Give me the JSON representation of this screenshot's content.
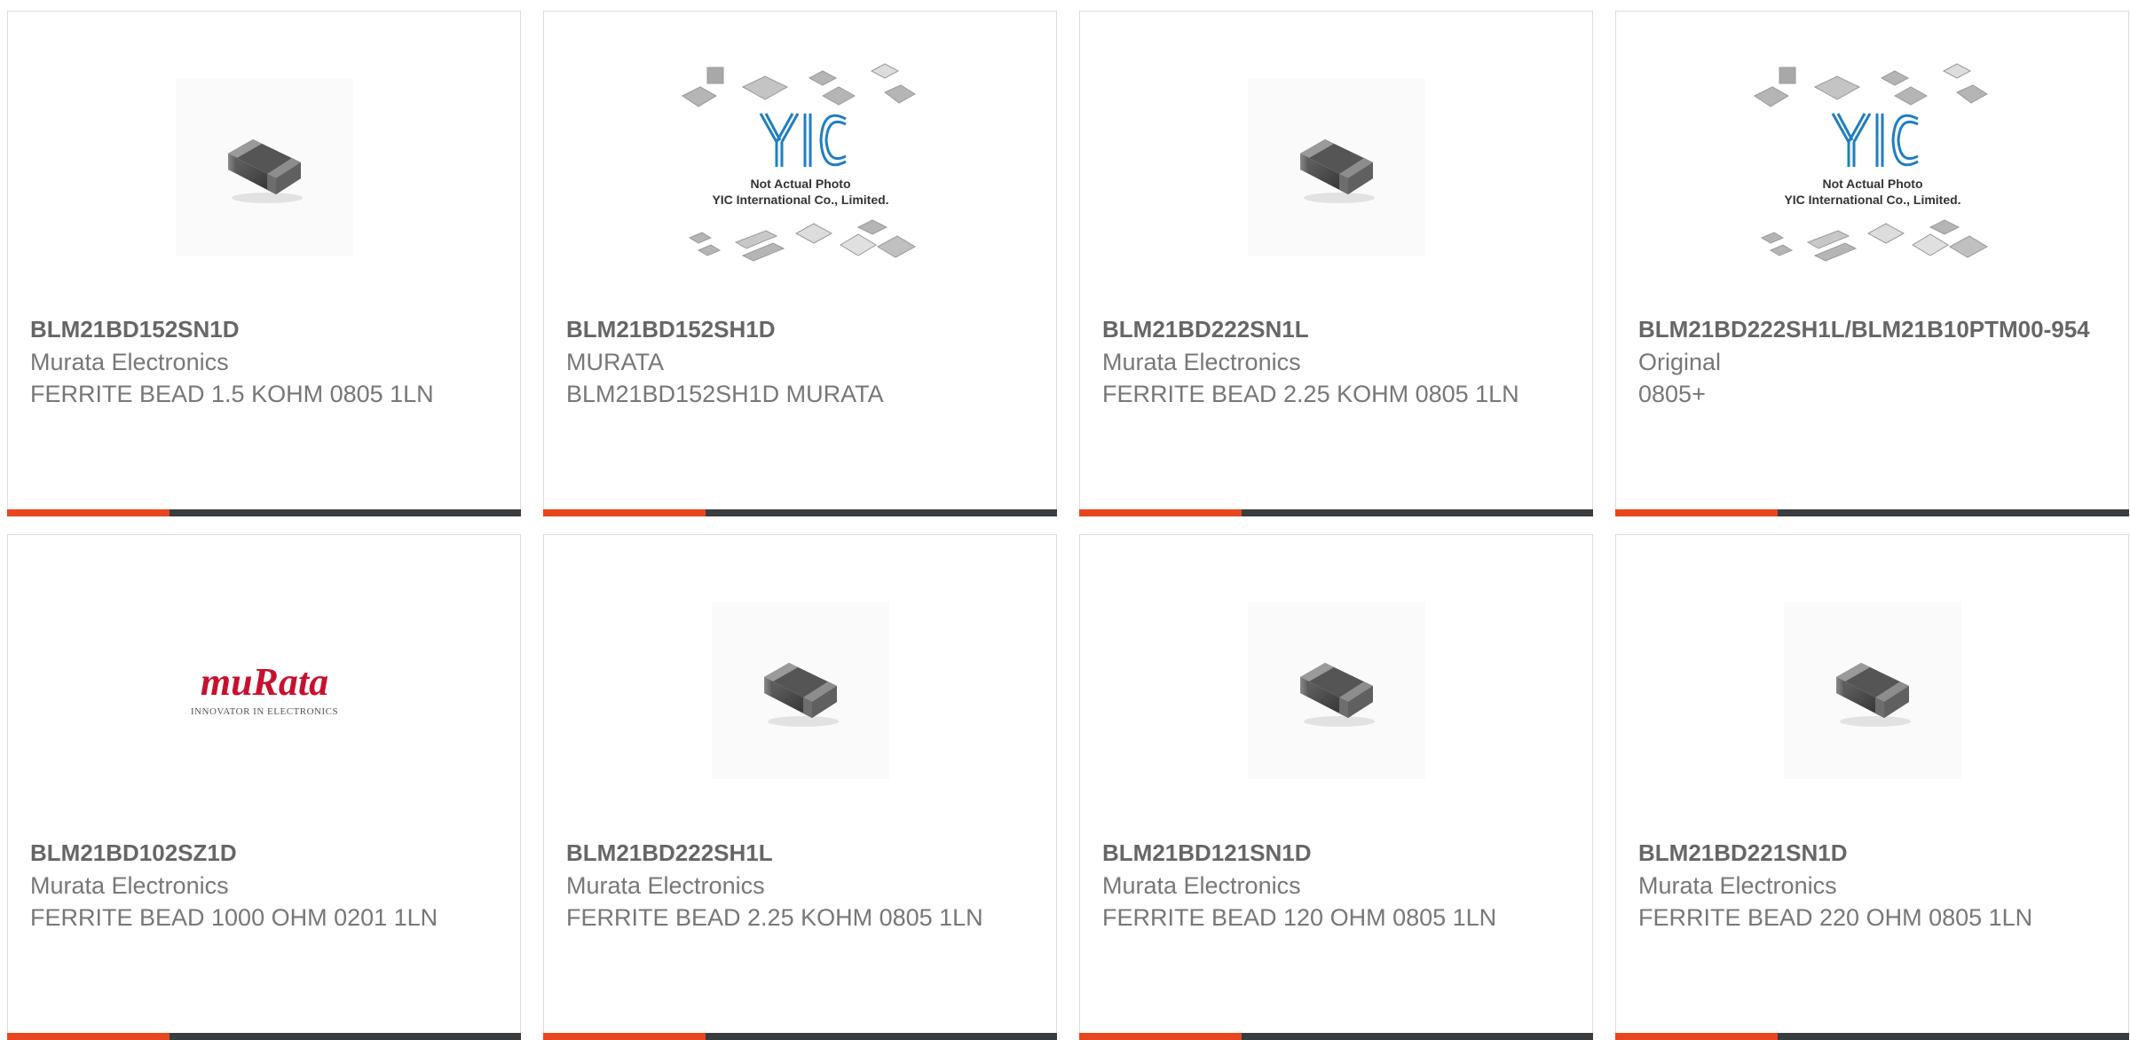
{
  "products": [
    {
      "part_number": "BLM21BD152SN1D",
      "manufacturer": "Murata Electronics",
      "description": "FERRITE BEAD 1.5 KOHM 0805 1LN",
      "image": "ferrite-bead-photo"
    },
    {
      "part_number": "BLM21BD152SH1D",
      "manufacturer": "MURATA",
      "description": "BLM21BD152SH1D MURATA",
      "image": "yic-placeholder-photo"
    },
    {
      "part_number": "BLM21BD222SN1L",
      "manufacturer": "Murata Electronics",
      "description": "FERRITE BEAD 2.25 KOHM 0805 1LN",
      "image": "ferrite-bead-photo"
    },
    {
      "part_number": "BLM21BD222SH1L/BLM21B10PTM00-954",
      "manufacturer": "Original",
      "description": "0805+",
      "image": "yic-placeholder-photo"
    },
    {
      "part_number": "BLM21BD102SZ1D",
      "manufacturer": "Murata Electronics",
      "description": "FERRITE BEAD 1000 OHM 0201 1LN",
      "image": "murata-logo"
    },
    {
      "part_number": "BLM21BD222SH1L",
      "manufacturer": "Murata Electronics",
      "description": "FERRITE BEAD 2.25 KOHM 0805 1LN",
      "image": "ferrite-bead-photo"
    },
    {
      "part_number": "BLM21BD121SN1D",
      "manufacturer": "Murata Electronics",
      "description": "FERRITE BEAD 120 OHM 0805 1LN",
      "image": "ferrite-bead-photo"
    },
    {
      "part_number": "BLM21BD221SN1D",
      "manufacturer": "Murata Electronics",
      "description": "FERRITE BEAD 220 OHM 0805 1LN",
      "image": "ferrite-bead-photo"
    }
  ],
  "placeholder": {
    "brand": "YIC",
    "line1": "Not Actual Photo",
    "line2": "YIC International Co., Limited."
  },
  "murata_logo": {
    "wordmark": "muRata",
    "tagline": "INNOVATOR IN ELECTRONICS"
  },
  "colors": {
    "accent": "#e8461e",
    "bar": "#3a3d40",
    "murata_red": "#c8102e",
    "yic_blue": "#1f7ec2"
  }
}
